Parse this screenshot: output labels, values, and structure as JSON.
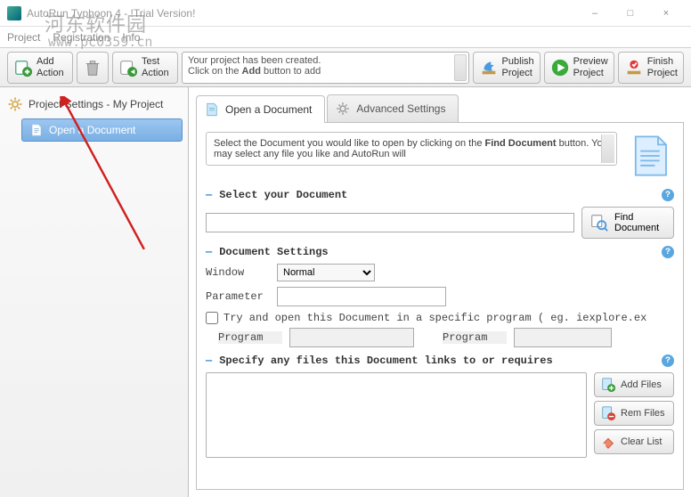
{
  "window": {
    "title": "AutoRun Typhoon 4 - !Trial Version!",
    "minimize": "–",
    "maximize": "□",
    "close": "×"
  },
  "menu": {
    "project": "Project",
    "registration": "Registration",
    "info": "Info"
  },
  "watermark": {
    "line1": "河东软件园",
    "line2": "www.pc0359.cn"
  },
  "toolbar": {
    "add": {
      "l1": "Add",
      "l2": "Action"
    },
    "test": {
      "l1": "Test",
      "l2": "Action"
    },
    "message": {
      "line1": "Your project has been created.",
      "line2_a": "Click on the ",
      "line2_b": "Add",
      "line2_c": " button to add"
    },
    "publish": {
      "l1": "Publish",
      "l2": "Project"
    },
    "preview": {
      "l1": "Preview",
      "l2": "Project"
    },
    "finish": {
      "l1": "Finish",
      "l2": "Project"
    }
  },
  "sidebar": {
    "root": "Project Settings - My Project",
    "item1": "Open a Document"
  },
  "tabs": {
    "open_doc": "Open a Document",
    "advanced": "Advanced Settings"
  },
  "panel": {
    "info_a": "Select the Document you would like to open by clicking on the ",
    "info_b": "Find Document",
    "info_c": " button. You may select any file you like and AutoRun will",
    "sec1": "Select your Document",
    "find_btn": {
      "l1": "Find",
      "l2": "Document"
    },
    "sec2": "Document Settings",
    "window_label": "Window",
    "window_value": "Normal",
    "param_label": "Parameter",
    "try_open": "Try and open this Document in a specific program ( eg. iexplore.ex",
    "program_label": "Program",
    "sec3": "Specify any files this Document links to or requires",
    "add_files": "Add Files",
    "rem_files": "Rem Files",
    "clear_list": "Clear List"
  }
}
